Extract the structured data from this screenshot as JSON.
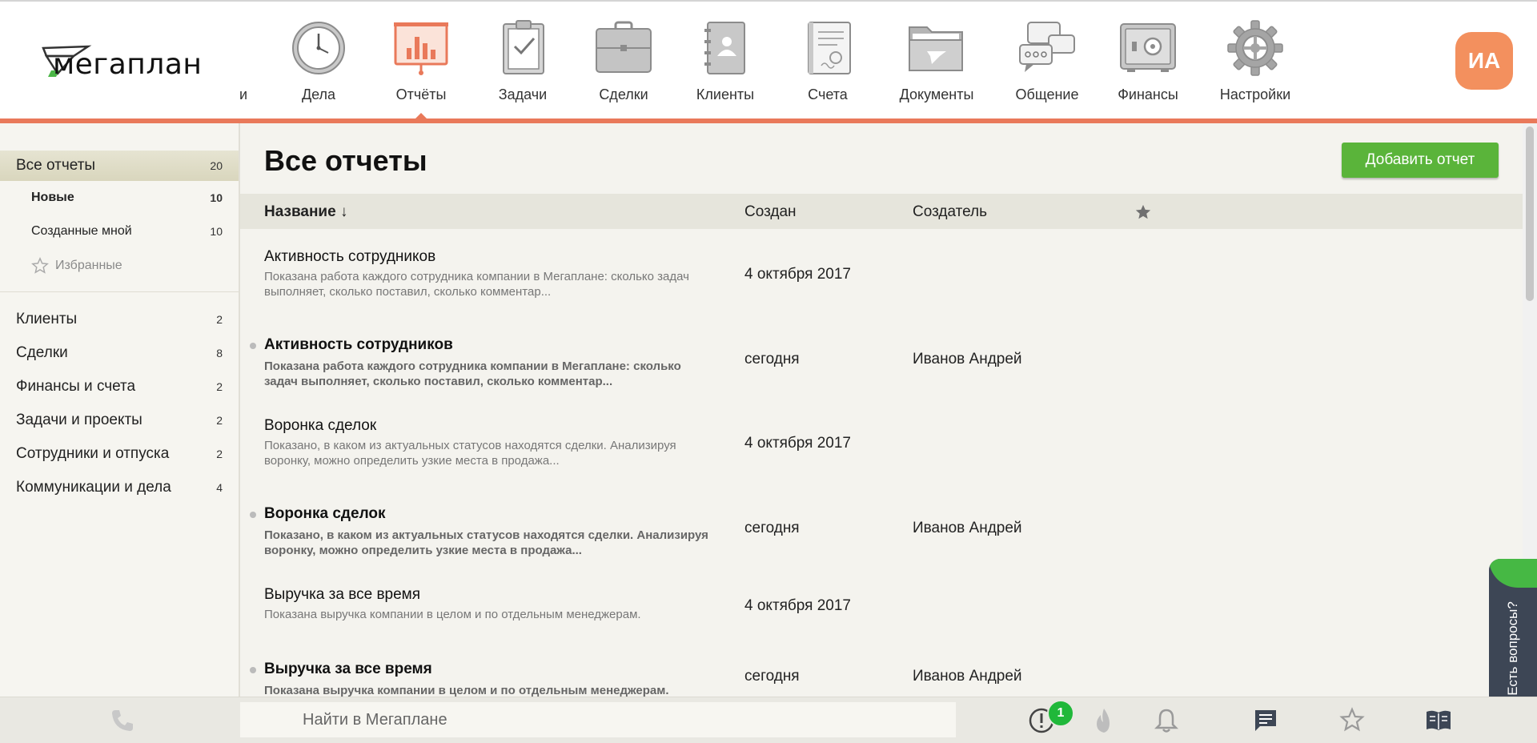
{
  "logo": {
    "text": "мегаплан"
  },
  "nav": {
    "cut_label": "и",
    "items": [
      {
        "label": "Дела",
        "icon": "clock-icon"
      },
      {
        "label": "Отчёты",
        "icon": "report-chart-icon",
        "active": true
      },
      {
        "label": "Задачи",
        "icon": "clipboard-check-icon"
      },
      {
        "label": "Сделки",
        "icon": "briefcase-icon"
      },
      {
        "label": "Клиенты",
        "icon": "contacts-book-icon"
      },
      {
        "label": "Счета",
        "icon": "invoice-icon"
      },
      {
        "label": "Документы",
        "icon": "folder-icon"
      },
      {
        "label": "Общение",
        "icon": "chat-bubbles-icon"
      },
      {
        "label": "Финансы",
        "icon": "safe-icon"
      },
      {
        "label": "Настройки",
        "icon": "gear-icon"
      }
    ]
  },
  "user": {
    "initials": "ИА"
  },
  "sidebar": {
    "top": {
      "label": "Все отчеты",
      "count": "20"
    },
    "sub": [
      {
        "label": "Новые",
        "count": "10"
      },
      {
        "label": "Созданные мной",
        "count": "10"
      },
      {
        "label": "Избранные",
        "count": ""
      }
    ],
    "categories": [
      {
        "label": "Клиенты",
        "count": "2"
      },
      {
        "label": "Сделки",
        "count": "8"
      },
      {
        "label": "Финансы и счета",
        "count": "2"
      },
      {
        "label": "Задачи и проекты",
        "count": "2"
      },
      {
        "label": "Сотрудники и отпуска",
        "count": "2"
      },
      {
        "label": "Коммуникации и дела",
        "count": "4"
      }
    ]
  },
  "main": {
    "title": "Все отчеты",
    "add_button": "Добавить отчет",
    "columns": {
      "name": "Название ↓",
      "created": "Создан",
      "creator": "Создатель"
    },
    "rows": [
      {
        "name": "Активность сотрудников",
        "desc": "Показана работа каждого сотрудника компании в Мегаплане: сколько задач выполняет, сколько поставил, сколько комментар...",
        "date": "4 октября 2017",
        "creator": "",
        "new": false
      },
      {
        "name": "Активность сотрудников",
        "desc": "Показана работа каждого сотрудника компании в Мегаплане: сколько задач выполняет, сколько поставил, сколько комментар...",
        "date": "сегодня",
        "creator": "Иванов Андрей",
        "new": true
      },
      {
        "name": "Воронка сделок",
        "desc": "Показано, в каком из актуальных статусов находятся сделки. Анализируя воронку, можно определить узкие места в продажа...",
        "date": "4 октября 2017",
        "creator": "",
        "new": false
      },
      {
        "name": "Воронка сделок",
        "desc": "Показано, в каком из актуальных статусов находятся сделки. Анализируя воронку, можно определить узкие места в продажа...",
        "date": "сегодня",
        "creator": "Иванов Андрей",
        "new": true
      },
      {
        "name": "Выручка за все время",
        "desc": "Показана выручка компании в целом и по отдельным менеджерам.",
        "date": "4 октября 2017",
        "creator": "",
        "new": false
      },
      {
        "name": "Выручка за все время",
        "desc": "Показана выручка компании в целом и по отдельным менеджерам.",
        "date": "сегодня",
        "creator": "Иванов Андрей",
        "new": true
      }
    ]
  },
  "help": {
    "label": "Есть вопросы?"
  },
  "bottom": {
    "search_placeholder": "Найти в Мегаплане",
    "alerts_badge": "1"
  },
  "colors": {
    "accent": "#e9795a",
    "green": "#5ab43a",
    "avatar": "#f3905e",
    "icon_gray": "#8c8c8c"
  }
}
